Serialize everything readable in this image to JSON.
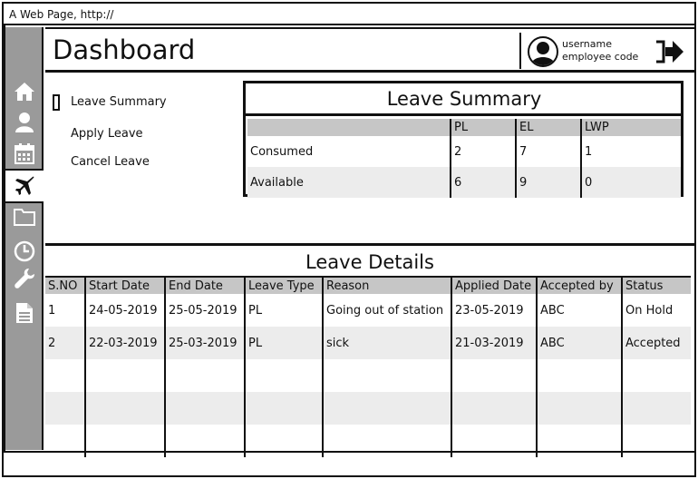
{
  "browser": {
    "title": "A Web Page, http://"
  },
  "header": {
    "title": "Dashboard",
    "username": "username",
    "employee_code": "employee code"
  },
  "sidebar": {
    "items": [
      {
        "icon": "home-icon"
      },
      {
        "icon": "user-icon"
      },
      {
        "icon": "calendar-icon"
      },
      {
        "icon": "airplane-icon",
        "active": true
      },
      {
        "icon": "folder-icon"
      },
      {
        "icon": "clock-icon"
      },
      {
        "icon": "wrench-icon"
      },
      {
        "icon": "document-icon"
      }
    ]
  },
  "leave_nav": {
    "items": [
      {
        "label": "Leave Summary"
      },
      {
        "label": "Apply Leave"
      },
      {
        "label": "Cancel Leave"
      }
    ]
  },
  "leave_summary": {
    "title": "Leave Summary",
    "columns": [
      "",
      "PL",
      "EL",
      "LWP"
    ],
    "rows": [
      [
        "Consumed",
        "2",
        "7",
        "1"
      ],
      [
        "Available",
        "6",
        "9",
        "0"
      ]
    ]
  },
  "leave_details": {
    "title": "Leave Details",
    "columns": [
      "S.NO",
      "Start Date",
      "End Date",
      "Leave Type",
      "Reason",
      "Applied Date",
      "Accepted by",
      "Status"
    ],
    "rows": [
      [
        "1",
        "24-05-2019",
        "25-05-2019",
        "PL",
        "Going out of station",
        "23-05-2019",
        "ABC",
        "On Hold"
      ],
      [
        "2",
        "22-03-2019",
        "25-03-2019",
        "PL",
        "sick",
        "21-03-2019",
        "ABC",
        "Accepted"
      ],
      [
        "",
        "",
        "",
        "",
        "",
        "",
        "",
        ""
      ],
      [
        "",
        "",
        "",
        "",
        "",
        "",
        "",
        ""
      ],
      [
        "",
        "",
        "",
        "",
        "",
        "",
        "",
        ""
      ]
    ]
  }
}
